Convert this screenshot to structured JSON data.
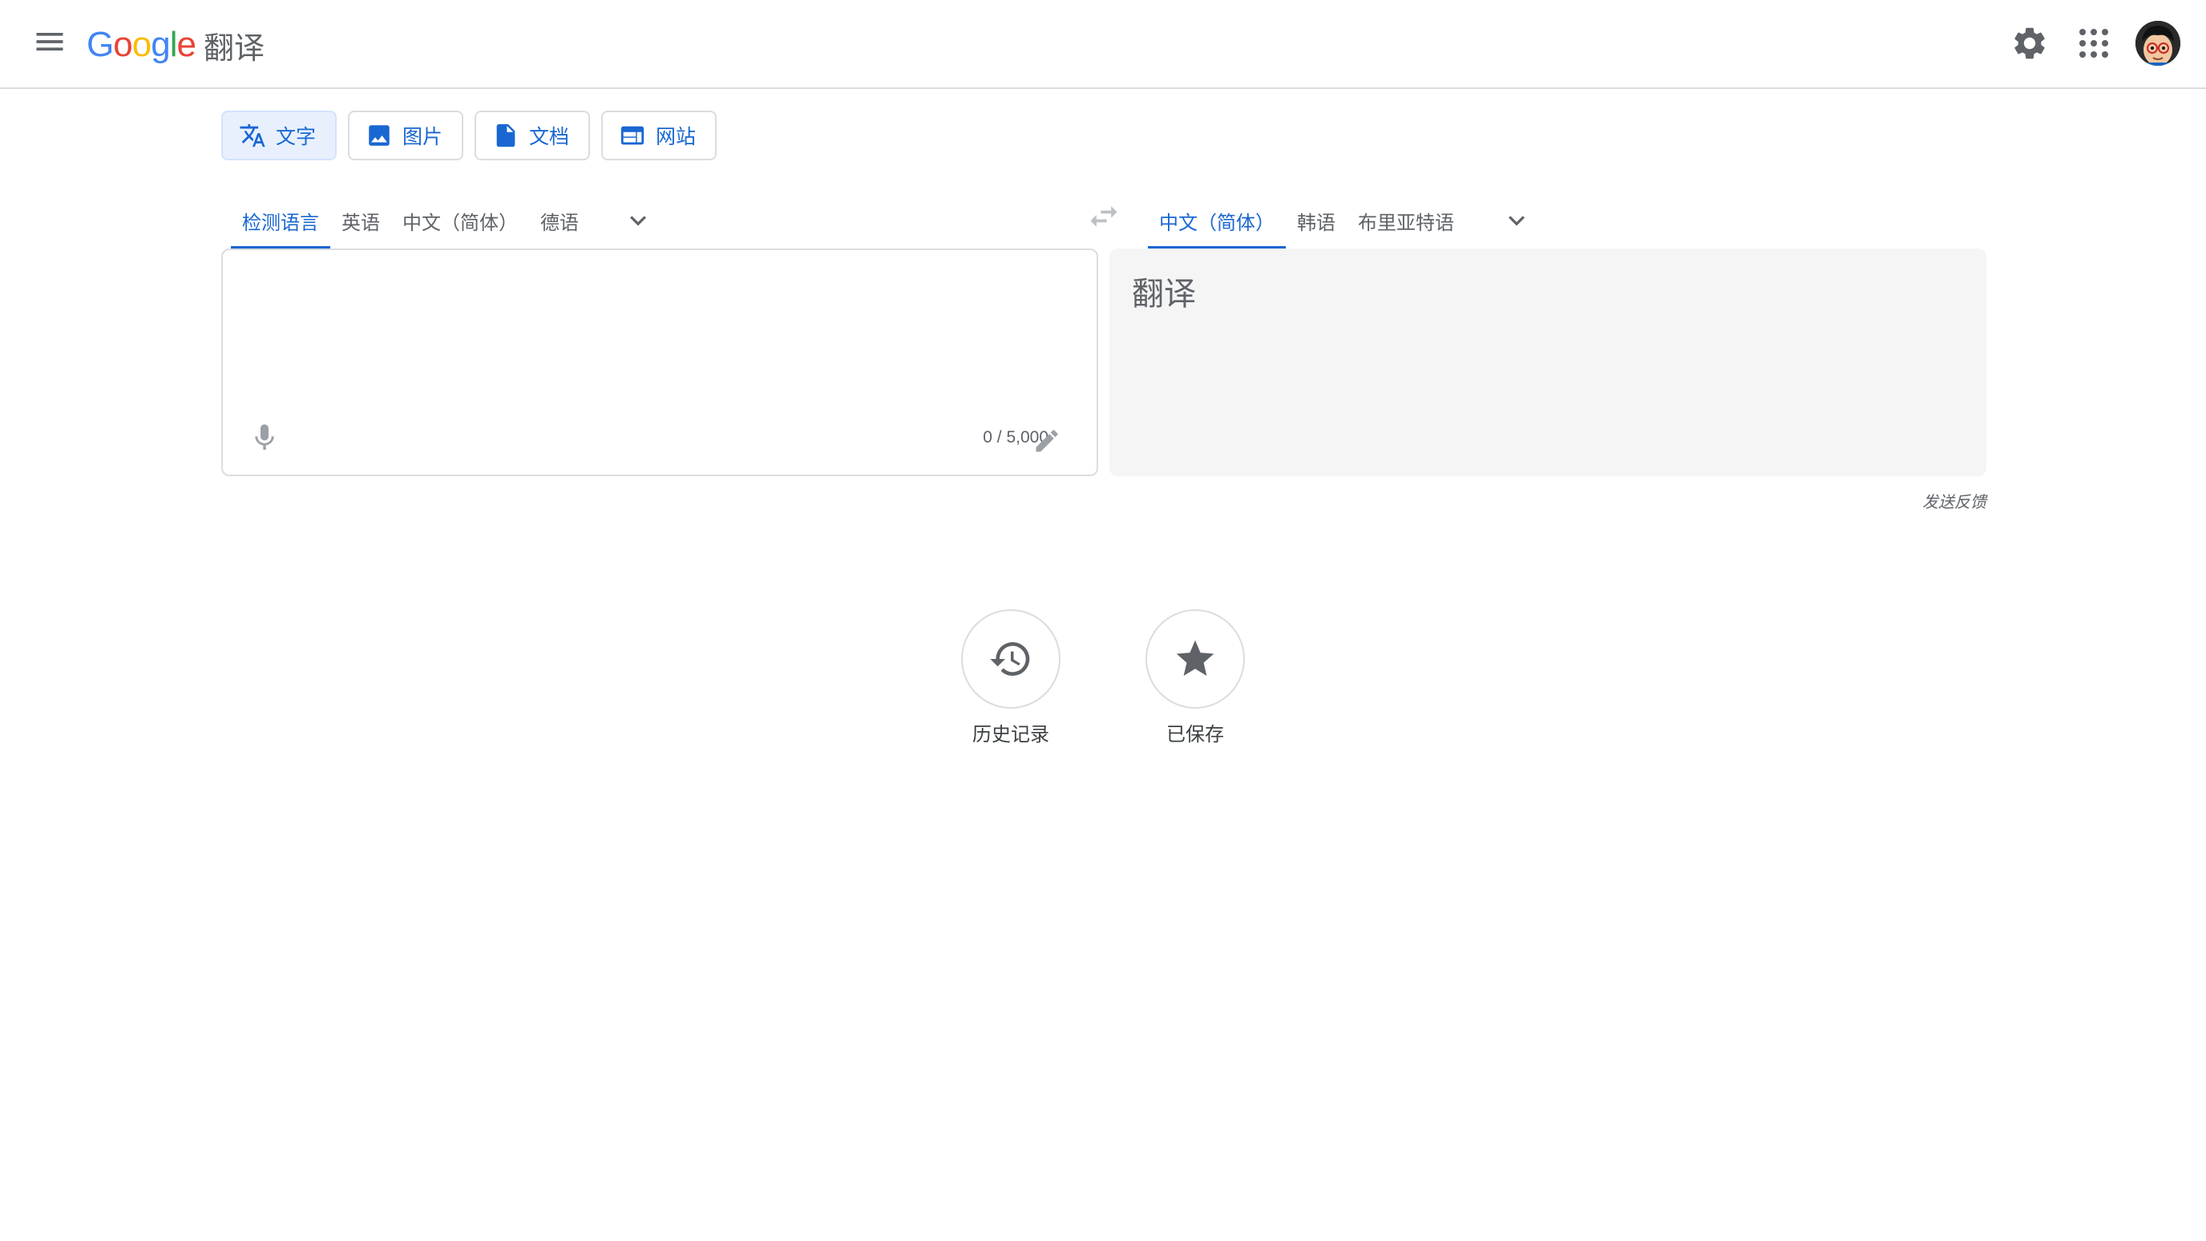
{
  "header": {
    "logo_letters": [
      "G",
      "o",
      "o",
      "g",
      "l",
      "e"
    ],
    "logo_suffix": "翻译"
  },
  "mode_tabs": [
    {
      "label": "文字",
      "active": true
    },
    {
      "label": "图片",
      "active": false
    },
    {
      "label": "文档",
      "active": false
    },
    {
      "label": "网站",
      "active": false
    }
  ],
  "source_langs": [
    {
      "label": "检测语言",
      "active": true
    },
    {
      "label": "英语",
      "active": false
    },
    {
      "label": "中文（简体）",
      "active": false
    },
    {
      "label": "德语",
      "active": false
    }
  ],
  "target_langs": [
    {
      "label": "中文（简体）",
      "active": true
    },
    {
      "label": "韩语",
      "active": false
    },
    {
      "label": "布里亚特语",
      "active": false
    }
  ],
  "source": {
    "value": "",
    "char_count": "0 / 5,000"
  },
  "target": {
    "placeholder": "翻译"
  },
  "feedback": "发送反馈",
  "bottom": {
    "history_label": "历史记录",
    "saved_label": "已保存"
  },
  "colors": {
    "accent": "#1967d2",
    "logo": [
      "#4285f4",
      "#ea4335",
      "#fbbc05",
      "#4285f4",
      "#34a853",
      "#ea4335"
    ]
  }
}
